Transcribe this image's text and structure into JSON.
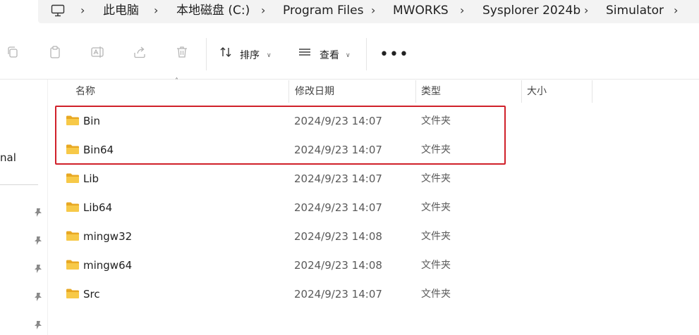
{
  "breadcrumb": {
    "items": [
      "此电脑",
      "本地磁盘 (C:)",
      "Program Files",
      "MWORKS",
      "Sysplorer 2024b",
      "Simulator"
    ]
  },
  "toolbar": {
    "sort_label": "排序",
    "view_label": "查看"
  },
  "navpane": {
    "partial_label": "nal"
  },
  "columns": {
    "name": "名称",
    "date": "修改日期",
    "type": "类型",
    "size": "大小"
  },
  "files": [
    {
      "name": "Bin",
      "date": "2024/9/23 14:07",
      "type": "文件夹"
    },
    {
      "name": "Bin64",
      "date": "2024/9/23 14:07",
      "type": "文件夹"
    },
    {
      "name": "Lib",
      "date": "2024/9/23 14:07",
      "type": "文件夹"
    },
    {
      "name": "Lib64",
      "date": "2024/9/23 14:07",
      "type": "文件夹"
    },
    {
      "name": "mingw32",
      "date": "2024/9/23 14:08",
      "type": "文件夹"
    },
    {
      "name": "mingw64",
      "date": "2024/9/23 14:08",
      "type": "文件夹"
    },
    {
      "name": "Src",
      "date": "2024/9/23 14:07",
      "type": "文件夹"
    }
  ],
  "colors": {
    "highlight": "#d0202a",
    "folder": "#f4c542"
  }
}
